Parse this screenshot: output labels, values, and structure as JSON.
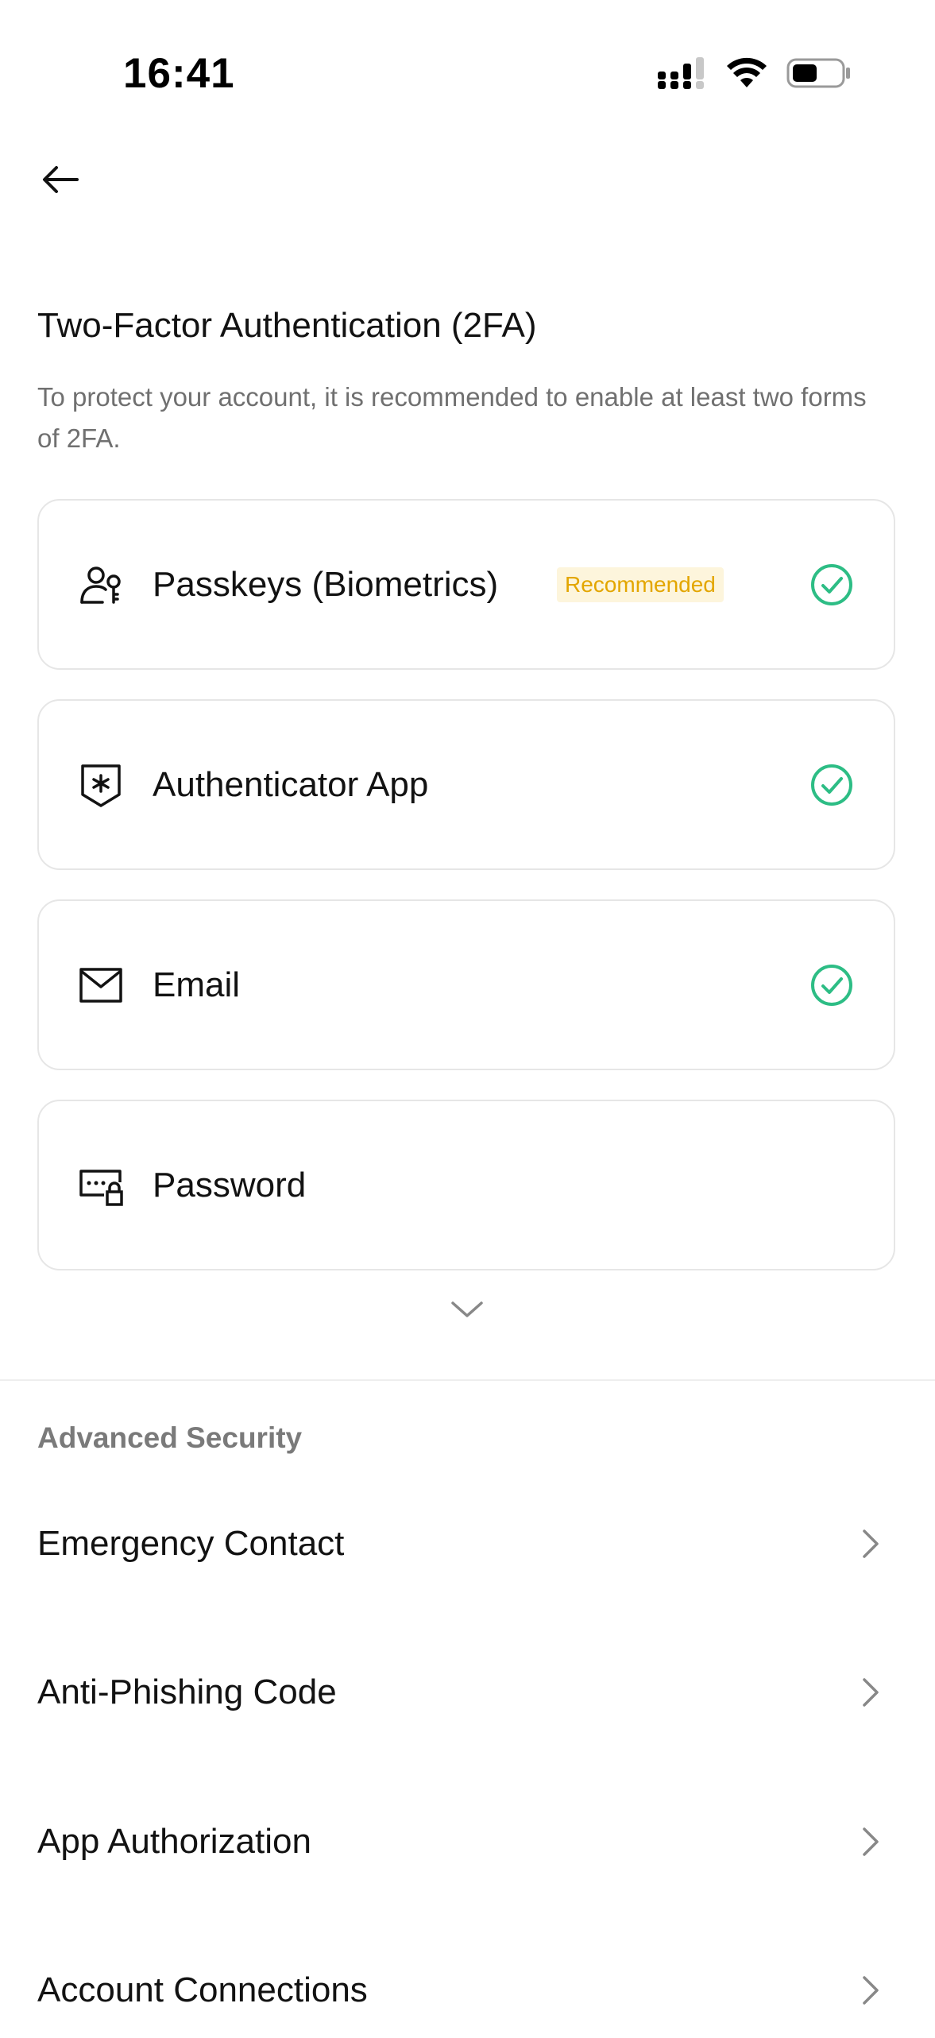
{
  "status_bar": {
    "time": "16:41",
    "icons": [
      "cellular-signal-icon",
      "wifi-icon",
      "battery-icon"
    ]
  },
  "header": {
    "back_icon": "arrow-left-icon"
  },
  "two_factor": {
    "title": "Two-Factor Authentication (2FA)",
    "description": "To protect your account, it is recommended to enable at least two forms of 2FA.",
    "methods": [
      {
        "label": "Passkeys (Biometrics)",
        "badge": "Recommended",
        "icon": "user-key-icon",
        "enabled": true
      },
      {
        "label": "Authenticator App",
        "icon": "shield-asterisk-icon",
        "enabled": true
      },
      {
        "label": "Email",
        "icon": "envelope-icon",
        "enabled": true
      },
      {
        "label": "Password",
        "icon": "password-lock-icon",
        "enabled": false
      }
    ],
    "expand_icon": "chevron-down-icon"
  },
  "advanced_security": {
    "title": "Advanced Security",
    "items": [
      {
        "label": "Emergency Contact"
      },
      {
        "label": "Anti-Phishing Code"
      },
      {
        "label": "App Authorization"
      },
      {
        "label": "Account Connections"
      }
    ]
  },
  "colors": {
    "text_primary": "#121212",
    "text_secondary": "#707070",
    "success_green": "#2dbd85",
    "badge_text": "#e3a600",
    "badge_bg": "#fdf5dc",
    "card_border": "#e6e6e6"
  }
}
